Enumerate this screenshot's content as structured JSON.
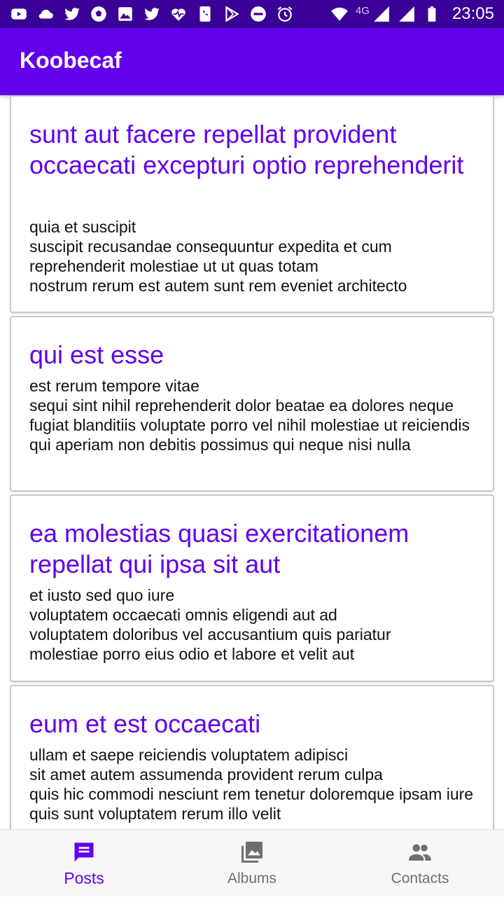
{
  "status_bar": {
    "network_label": "4G",
    "time": "23:05",
    "left_icons": [
      "youtube-icon",
      "cloud-icon",
      "twitter-icon",
      "soccer-ball-icon",
      "photo-icon",
      "twitter-icon",
      "heart-monitor-icon",
      "phone-icon",
      "play-store-icon",
      "do-not-disturb-icon",
      "alarm-icon"
    ],
    "right_icons": [
      "wifi-icon",
      "signal-icon",
      "signal-icon",
      "battery-icon"
    ]
  },
  "app_bar": {
    "title": "Koobecaf"
  },
  "posts": [
    {
      "title": "sunt aut facere repellat provident occaecati excepturi optio reprehenderit",
      "body": "quia et suscipit\nsuscipit recusandae consequuntur expedita et cum\nreprehenderit molestiae ut ut quas totam\nnostrum rerum est autem sunt rem eveniet architecto"
    },
    {
      "title": "qui est esse",
      "body": "est rerum tempore vitae\nsequi sint nihil reprehenderit dolor beatae ea dolores neque\nfugiat blanditiis voluptate porro vel nihil molestiae ut reiciendis\nqui aperiam non debitis possimus qui neque nisi nulla"
    },
    {
      "title": "ea molestias quasi exercitationem repellat qui ipsa sit aut",
      "body": "et iusto sed quo iure\nvoluptatem occaecati omnis eligendi aut ad\nvoluptatem doloribus vel accusantium quis pariatur\nmolestiae porro eius odio et labore et velit aut"
    },
    {
      "title": "eum et est occaecati",
      "body": "ullam et saepe reiciendis voluptatem adipisci\nsit amet autem assumenda provident rerum culpa\nquis hic commodi nesciunt rem tenetur doloremque ipsam iure\nquis sunt voluptatem rerum illo velit"
    }
  ],
  "bottom_nav": {
    "items": [
      {
        "label": "Posts",
        "icon": "posts-icon",
        "active": true
      },
      {
        "label": "Albums",
        "icon": "albums-icon",
        "active": false
      },
      {
        "label": "Contacts",
        "icon": "contacts-icon",
        "active": false
      }
    ]
  },
  "colors": {
    "primary": "#6200ee",
    "status_bar": "#3a0097",
    "inactive_nav": "#6f6f6f"
  }
}
